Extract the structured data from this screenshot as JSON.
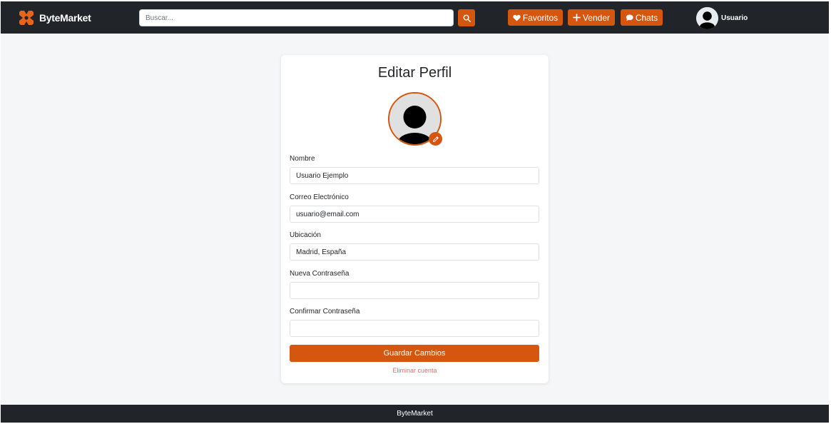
{
  "header": {
    "brand": "ByteMarket",
    "search_placeholder": "Buscar...",
    "buttons": {
      "favorites": "Favoritos",
      "sell": "Vender",
      "chats": "Chats"
    },
    "user_name": "Usuario",
    "icons": {
      "logo": "bytemarket-x-logo",
      "search": "search-icon",
      "favorites": "heart-icon",
      "sell": "plus-icon",
      "chats": "chat-bubble-icon",
      "avatar": "user-avatar-icon"
    }
  },
  "profile_form": {
    "title": "Editar Perfil",
    "fields": {
      "name": {
        "label": "Nombre",
        "value": "Usuario Ejemplo"
      },
      "email": {
        "label": "Correo Electrónico",
        "value": "usuario@email.com"
      },
      "location": {
        "label": "Ubicación",
        "value": "Madrid, España"
      },
      "new_password": {
        "label": "Nueva Contraseña",
        "value": ""
      },
      "confirm_password": {
        "label": "Confirmar Contraseña",
        "value": ""
      }
    },
    "save_label": "Guardar Cambios",
    "delete_label": "Eliminar cuenta",
    "icons": {
      "profile_picture": "user-avatar-icon",
      "edit": "pencil-icon"
    }
  },
  "footer": {
    "text": "ByteMarket"
  },
  "colors": {
    "accent": "#d4560f",
    "nav_background": "#212529",
    "page_background": "#f5f6f7",
    "danger_link": "#dc6a6a"
  }
}
